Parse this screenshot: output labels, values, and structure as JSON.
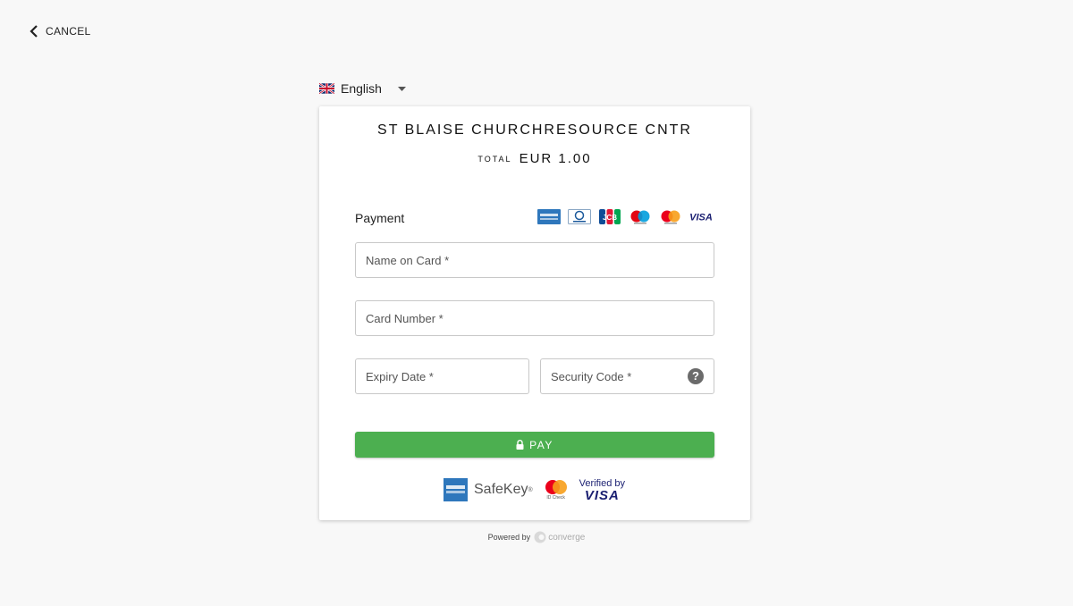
{
  "nav": {
    "cancel_label": "CANCEL"
  },
  "language": {
    "selected": "English"
  },
  "merchant": {
    "name": "ST BLAISE CHURCHRESOURCE CNTR"
  },
  "total": {
    "label": "TOTAL",
    "amount": "EUR 1.00"
  },
  "payment": {
    "label": "Payment",
    "brand_icons": [
      "amex-icon",
      "diners-club-icon",
      "jcb-icon",
      "maestro-icon",
      "mastercard-icon",
      "visa-icon"
    ],
    "brand_visa_text": "VISA"
  },
  "form": {
    "name_placeholder": "Name on Card *",
    "number_placeholder": "Card Number *",
    "expiry_placeholder": "Expiry Date *",
    "cvv_placeholder": "Security Code *",
    "cvv_help": "?"
  },
  "pay_button": {
    "label": "PAY"
  },
  "security": {
    "safekey_label": "SafeKey",
    "safekey_mark": "®",
    "mc_id_check_caption": "ID Check",
    "visa_verified_line1": "Verified by",
    "visa_verified_line2": "VISA"
  },
  "footer": {
    "powered_by": "Powered by",
    "provider": "converge"
  },
  "colors": {
    "pay_green": "#4caf50",
    "visa_blue": "#1a1f71",
    "mc_red": "#eb001b",
    "mc_orange": "#f79e1b"
  }
}
